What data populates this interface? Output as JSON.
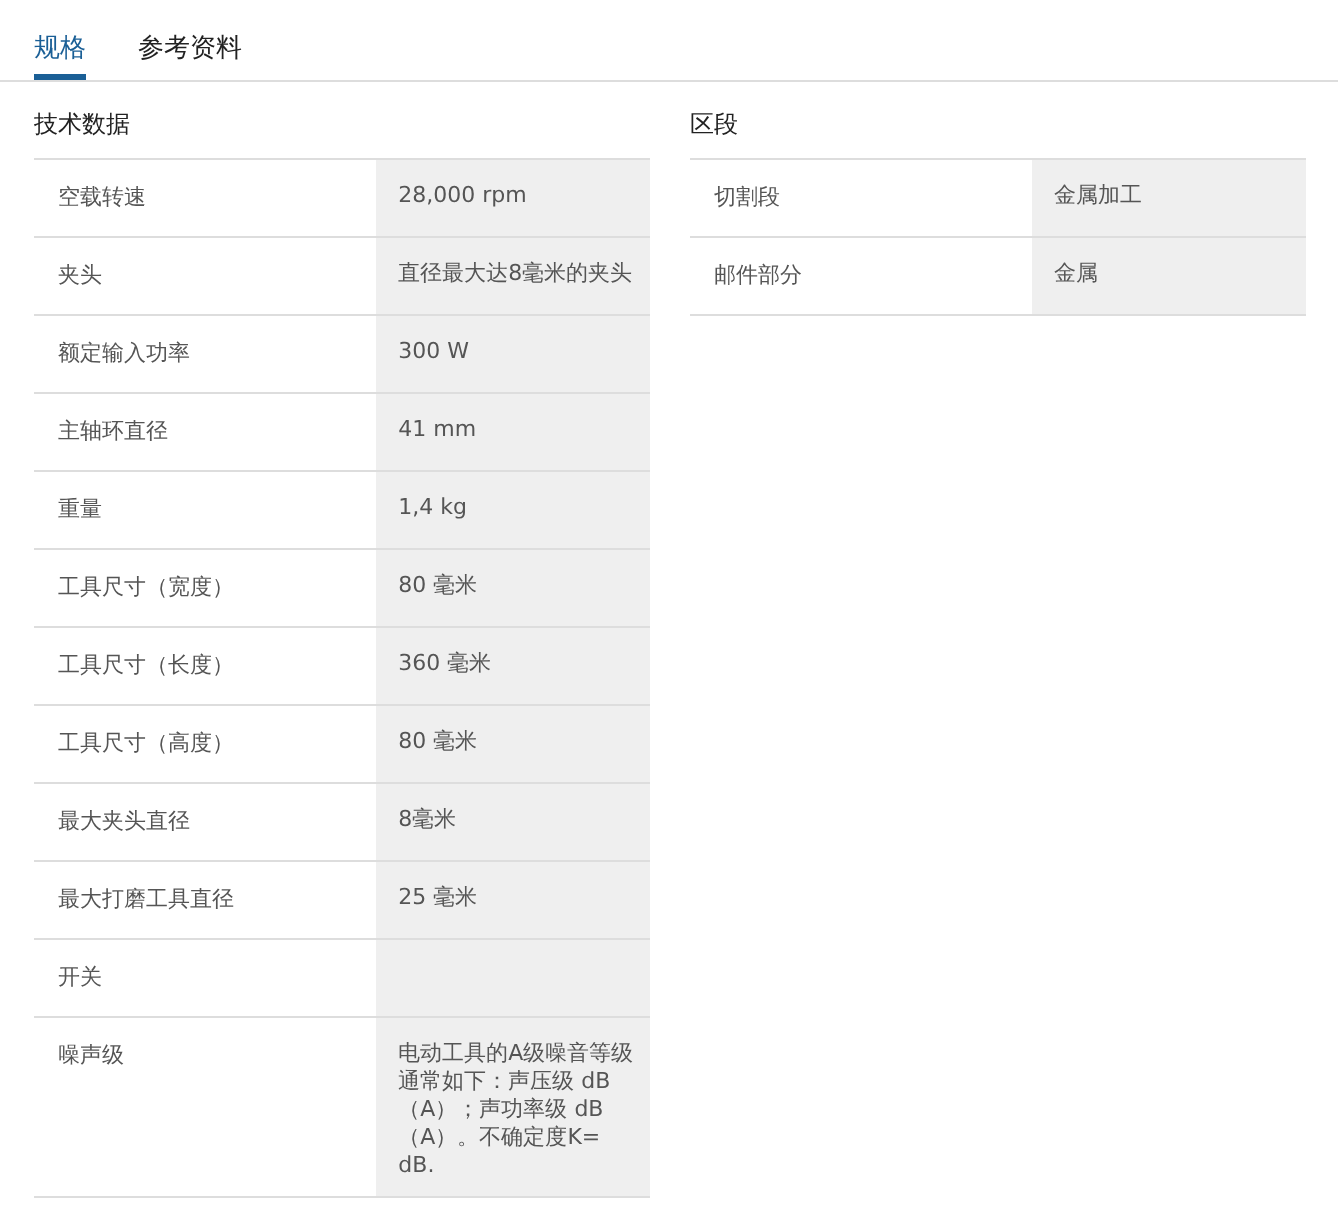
{
  "tabs": [
    {
      "label": "规格",
      "selected": true
    },
    {
      "label": "参考资料",
      "selected": false
    }
  ],
  "sections": [
    {
      "title": "技术数据",
      "rows": [
        {
          "label": "空载转速",
          "value": "28,000 rpm"
        },
        {
          "label": "夹头",
          "value": "直径最大达8毫米的夹头"
        },
        {
          "label": "额定输入功率",
          "value": "300 W"
        },
        {
          "label": "主轴环直径",
          "value": "41 mm"
        },
        {
          "label": "重量",
          "value": "1,4 kg"
        },
        {
          "label": "工具尺寸（宽度）",
          "value": "80 毫米"
        },
        {
          "label": "工具尺寸（长度）",
          "value": "360 毫米"
        },
        {
          "label": "工具尺寸（高度）",
          "value": "80 毫米"
        },
        {
          "label": "最大夹头直径",
          "value": "8毫米"
        },
        {
          "label": "最大打磨工具直径",
          "value": "25 毫米"
        },
        {
          "label": "开关"
        },
        {
          "label": "噪声级",
          "value": "电动工具的A级噪音等级通常如下：声压级 dB（A）；声功率级 dB（A）。不确定度K= dB."
        }
      ]
    },
    {
      "title": "区段",
      "rows": [
        {
          "label": "切割段",
          "value": "金属加工"
        },
        {
          "label": "邮件部分",
          "value": "金属"
        }
      ]
    }
  ]
}
